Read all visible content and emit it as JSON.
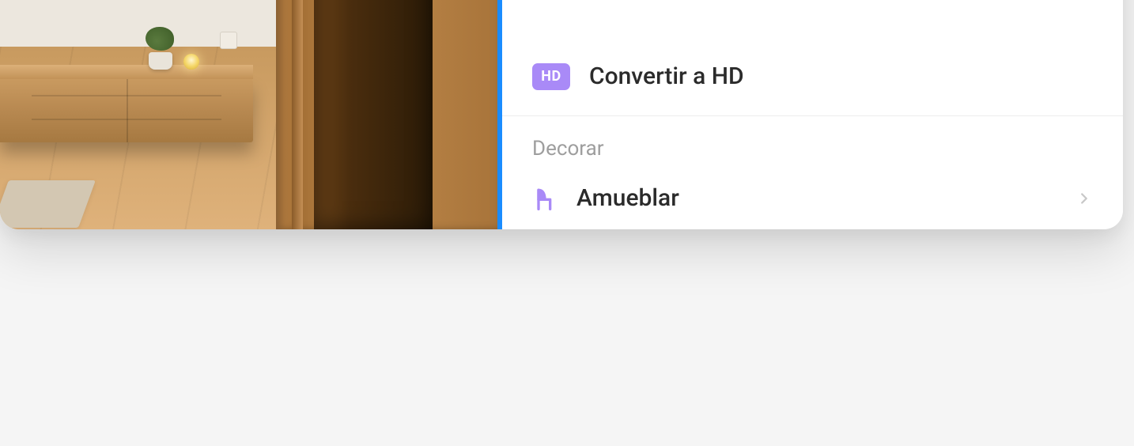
{
  "menu": {
    "convert_hd": {
      "badge_text": "HD",
      "label": "Convertir a HD"
    },
    "section_decorate": {
      "header": "Decorar",
      "items": {
        "furnish": {
          "label": "Amueblar"
        }
      }
    }
  },
  "colors": {
    "accent_purple": "#a98af7",
    "selection_blue": "#1a8cff"
  }
}
